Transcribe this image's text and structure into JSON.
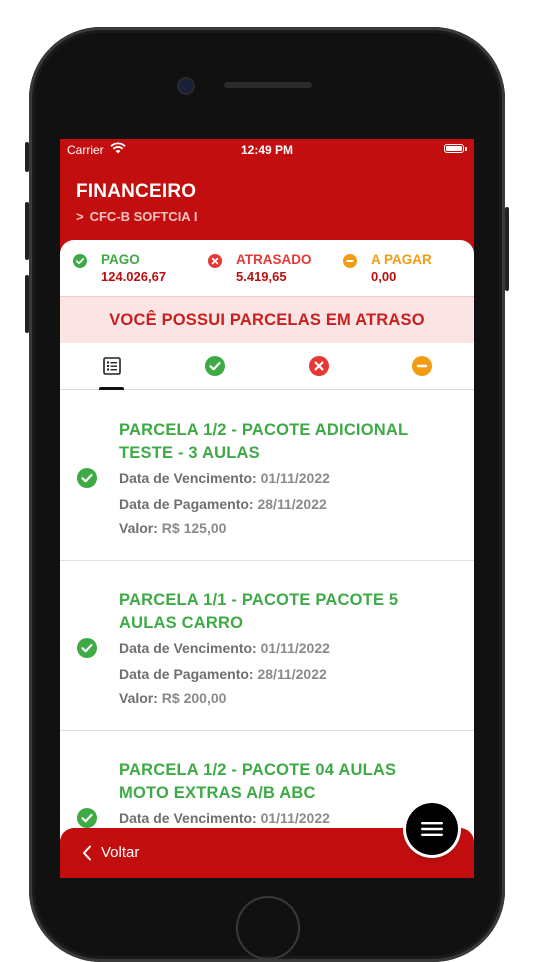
{
  "status_bar": {
    "carrier": "Carrier",
    "time": "12:49 PM"
  },
  "header": {
    "title": "FINANCEIRO",
    "breadcrumb": "CFC-B SOFTCIA I"
  },
  "summary": [
    {
      "label": "PAGO",
      "value": "124.026,67",
      "color": "#3eaa46",
      "icon": "check-circle-icon"
    },
    {
      "label": "ATRASADO",
      "value": "5.419,65",
      "color": "#e53935",
      "icon": "x-circle-icon"
    },
    {
      "label": "A PAGAR",
      "value": "0,00",
      "color": "#f39c12",
      "icon": "minus-circle-icon"
    }
  ],
  "alert": "VOCÊ POSSUI PARCELAS EM ATRASO",
  "tabs": [
    {
      "name": "list-icon",
      "active": true
    },
    {
      "name": "check-circle-icon",
      "color": "#3eaa46"
    },
    {
      "name": "x-circle-icon",
      "color": "#e53935"
    },
    {
      "name": "minus-circle-icon",
      "color": "#f39c12"
    }
  ],
  "labels": {
    "due": "Data de Vencimento:",
    "paid": "Data de Pagamento:",
    "value": "Valor:"
  },
  "installments": [
    {
      "title": "PARCELA 1/2 - PACOTE ADICIONAL TESTE - 3 AULAS",
      "due_date": "01/11/2022",
      "payment_date": "28/11/2022",
      "amount": "R$ 125,00",
      "status": "paid"
    },
    {
      "title": "PARCELA 1/1 - PACOTE PACOTE 5 AULAS CARRO",
      "due_date": "01/11/2022",
      "payment_date": "28/11/2022",
      "amount": "R$ 200,00",
      "status": "paid"
    },
    {
      "title": "PARCELA 1/2 - PACOTE 04 AULAS MOTO EXTRAS A/B ABC",
      "due_date": "01/11/2022",
      "status": "paid"
    }
  ],
  "footer": {
    "back_label": "Voltar"
  },
  "fab": {
    "icon": "menu-icon"
  }
}
